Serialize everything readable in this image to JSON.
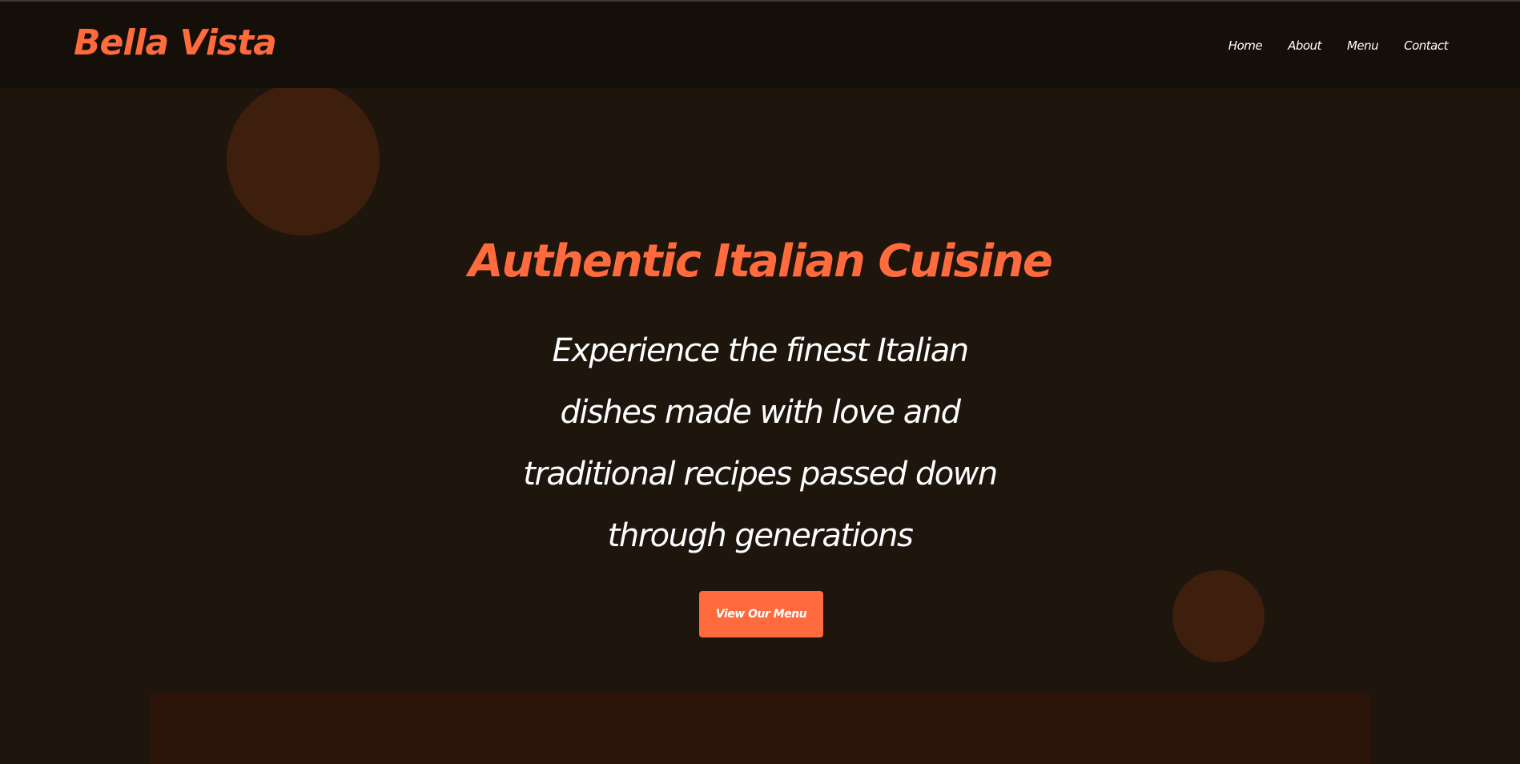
{
  "brand": {
    "name": "Bella Vista",
    "accent_color": "#ff6b3d"
  },
  "nav": {
    "items": [
      {
        "label": "Home"
      },
      {
        "label": "About"
      },
      {
        "label": "Menu"
      },
      {
        "label": "Contact"
      }
    ]
  },
  "hero": {
    "title": "Authentic Italian Cuisine",
    "subtitle": "Experience the finest Italian dishes made with love and traditional recipes passed down through generations",
    "cta_label": "View Our Menu"
  },
  "colors": {
    "background": "#1e150d",
    "header": "#150f0a",
    "decor_circle": "#3e1f0e",
    "text": "#ffffff"
  }
}
